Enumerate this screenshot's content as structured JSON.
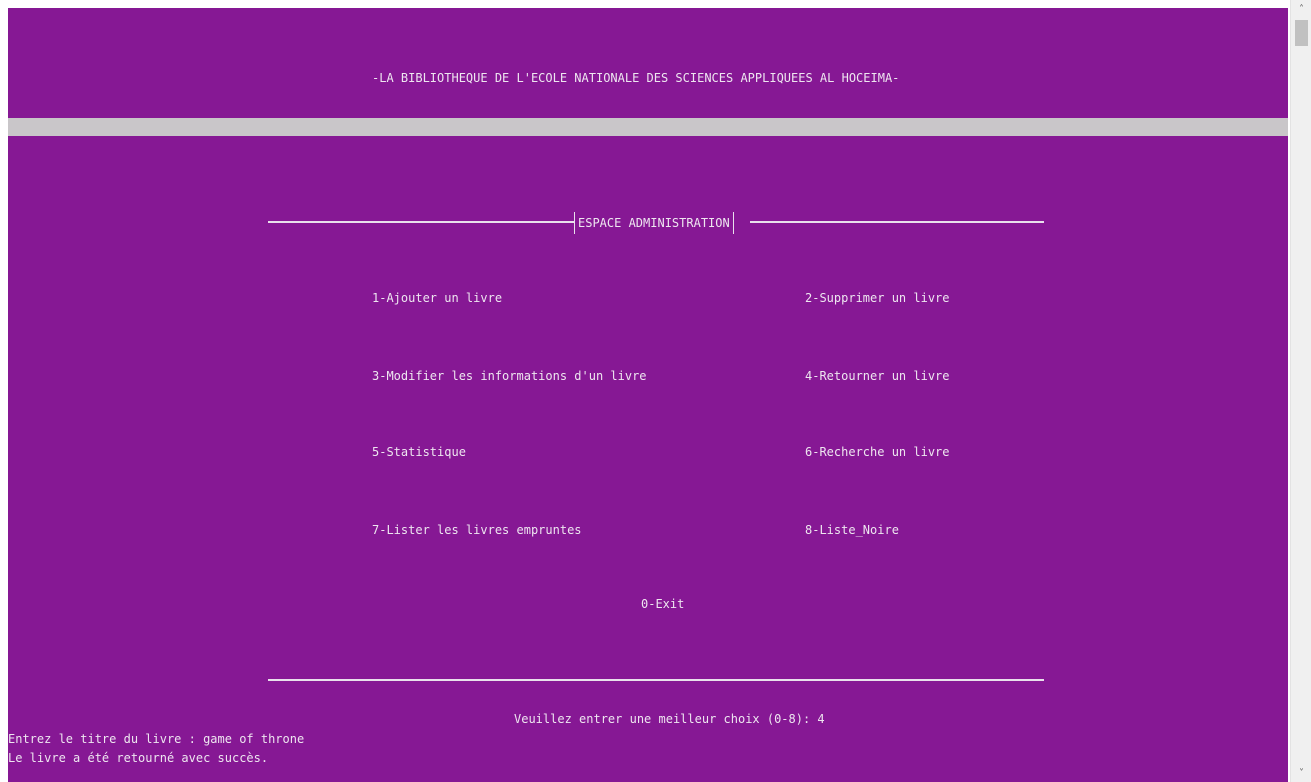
{
  "colors": {
    "console_background": "#861894",
    "console_text": "#eee6f0",
    "separator_bar": "#c9c6c9"
  },
  "header": {
    "title": "-LA BIBLIOTHEQUE DE L'ECOLE NATIONALE DES SCIENCES APPLIQUEES AL HOCEIMA-"
  },
  "section": {
    "title": "ESPACE ADMINISTRATION"
  },
  "menu": {
    "items": [
      "1-Ajouter un livre",
      "2-Supprimer un livre",
      "3-Modifier les informations d'un livre",
      "4-Retourner un livre",
      "5-Statistique",
      "6-Recherche un livre",
      "7-Lister les livres empruntes",
      "8-Liste_Noire",
      "0-Exit"
    ]
  },
  "prompt": {
    "text": "Veuillez entrer une meilleur choix (0-8): 4"
  },
  "output": {
    "line1": "Entrez le titre du livre : game of throne",
    "line2": "Le livre a été retourné avec succès."
  },
  "scrollbar": {
    "up_icon": "chevron-up-icon",
    "down_icon": "chevron-down-icon"
  }
}
